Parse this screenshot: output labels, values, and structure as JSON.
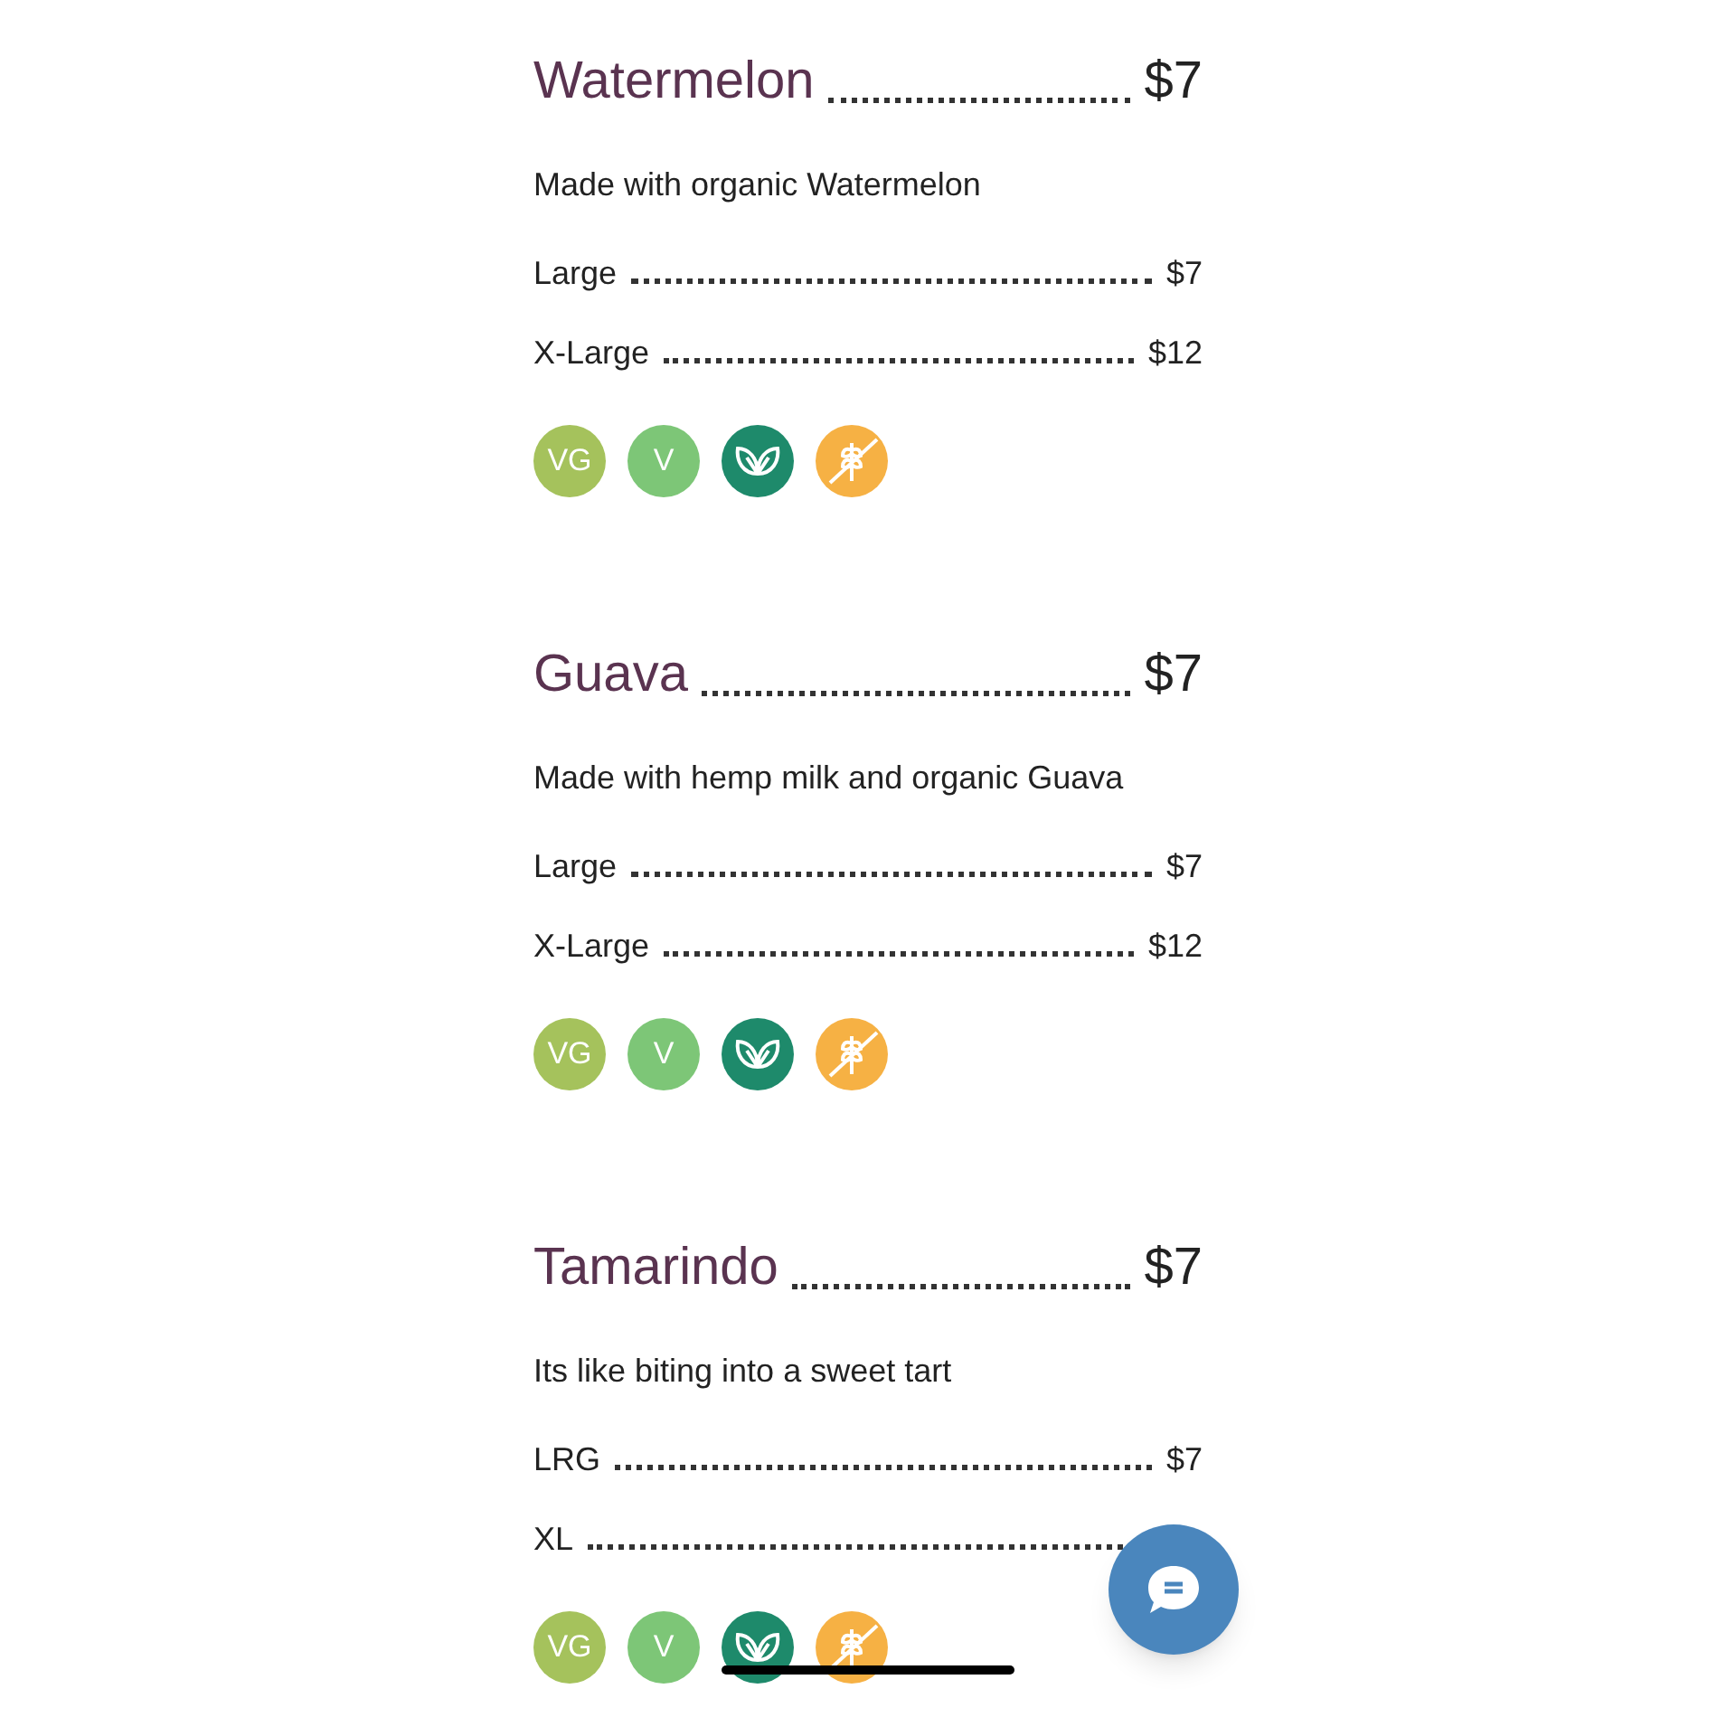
{
  "items": [
    {
      "name": "Watermelon",
      "price": "$7",
      "description": "Made with organic Watermelon",
      "sizes": [
        {
          "label": "Large",
          "price": "$7"
        },
        {
          "label": "X-Large",
          "price": "$12"
        }
      ],
      "badges": [
        {
          "kind": "text",
          "text": "VG",
          "color": "#a5c25c"
        },
        {
          "kind": "text",
          "text": "V",
          "color": "#7dc677"
        },
        {
          "kind": "leaf",
          "color": "#1e8a6b"
        },
        {
          "kind": "wheat",
          "color": "#f6b144"
        }
      ]
    },
    {
      "name": "Guava",
      "price": "$7",
      "description": "Made with hemp milk and organic Guava",
      "sizes": [
        {
          "label": "Large",
          "price": "$7"
        },
        {
          "label": "X-Large",
          "price": "$12"
        }
      ],
      "badges": [
        {
          "kind": "text",
          "text": "VG",
          "color": "#a5c25c"
        },
        {
          "kind": "text",
          "text": "V",
          "color": "#7dc677"
        },
        {
          "kind": "leaf",
          "color": "#1e8a6b"
        },
        {
          "kind": "wheat",
          "color": "#f6b144"
        }
      ]
    },
    {
      "name": "Tamarindo",
      "price": "$7",
      "description": "Its like biting into a sweet tart",
      "sizes": [
        {
          "label": "LRG",
          "price": "$7"
        },
        {
          "label": "XL"
        }
      ],
      "badges": [
        {
          "kind": "text",
          "text": "VG",
          "color": "#a5c25c"
        },
        {
          "kind": "text",
          "text": "V",
          "color": "#7dc677"
        },
        {
          "kind": "leaf",
          "color": "#1e8a6b"
        },
        {
          "kind": "wheat",
          "color": "#f6b144"
        }
      ]
    }
  ]
}
